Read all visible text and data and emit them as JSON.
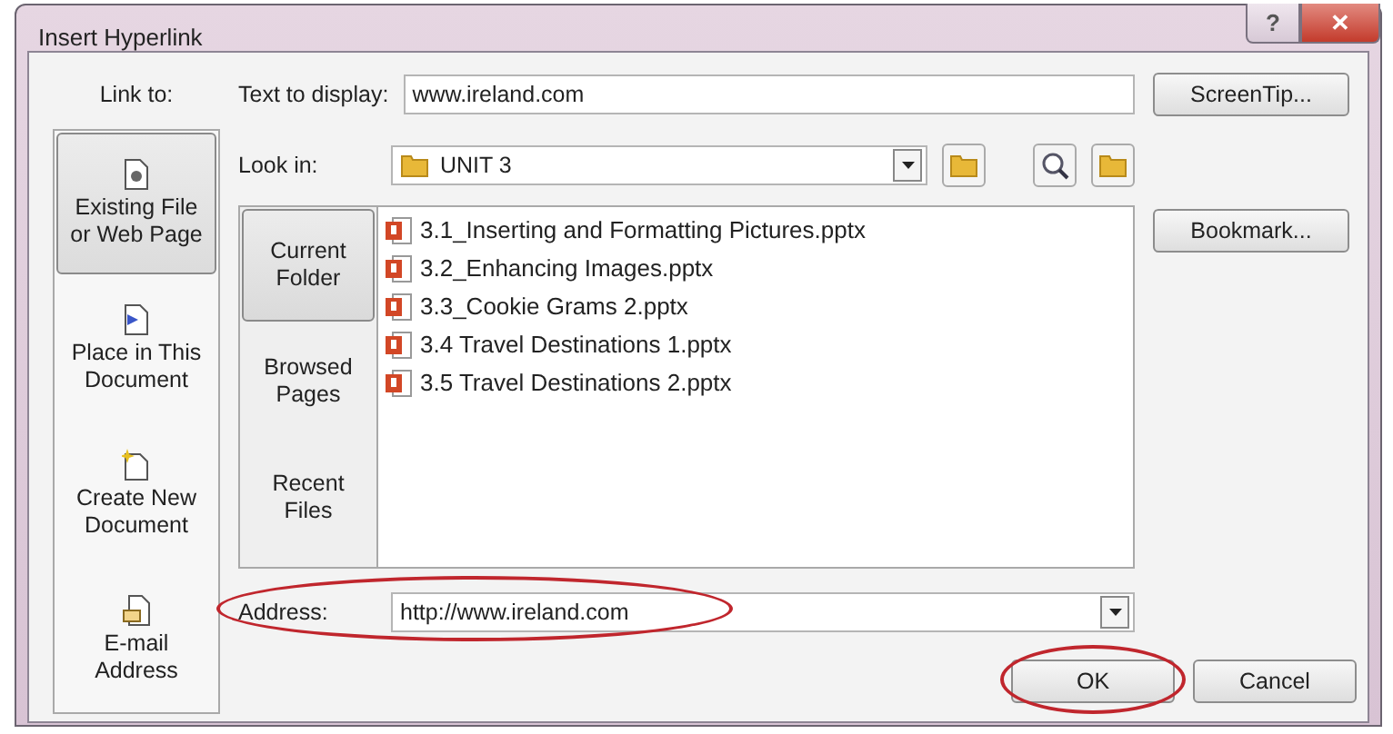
{
  "window": {
    "title": "Insert Hyperlink",
    "controls": [
      {
        "kind": "help",
        "label": "?"
      },
      {
        "kind": "close",
        "label": "✕"
      }
    ]
  },
  "link_to": {
    "label": "Link to:",
    "items": [
      {
        "kind": "file",
        "label": "Existing File\nor Web Page",
        "selected": true
      },
      {
        "kind": "place",
        "label": "Place in This\nDocument",
        "selected": false
      },
      {
        "kind": "new",
        "label": "Create New\nDocument",
        "selected": false
      },
      {
        "kind": "mail",
        "label": "E-mail\nAddress",
        "selected": false
      }
    ]
  },
  "text_to_display": {
    "label": "Text to display:",
    "value": "www.ireland.com"
  },
  "look_in": {
    "label": "Look in:",
    "value": "UNIT 3"
  },
  "browse_tabs": [
    {
      "label": "Current\nFolder",
      "selected": true
    },
    {
      "label": "Browsed\nPages",
      "selected": false
    },
    {
      "label": "Recent\nFiles",
      "selected": false
    }
  ],
  "files": [
    "3.1_Inserting and Formatting Pictures.pptx",
    "3.2_Enhancing Images.pptx",
    "3.3_Cookie Grams 2.pptx",
    "3.4 Travel Destinations 1.pptx",
    "3.5 Travel Destinations 2.pptx"
  ],
  "address": {
    "label": "Address:",
    "value": "http://www.ireland.com",
    "highlighted": true
  },
  "side_buttons": [
    "ScreenTip...",
    "Bookmark..."
  ],
  "footer_buttons": [
    {
      "label": "OK",
      "highlighted": true
    },
    {
      "label": "Cancel",
      "highlighted": false
    }
  ]
}
